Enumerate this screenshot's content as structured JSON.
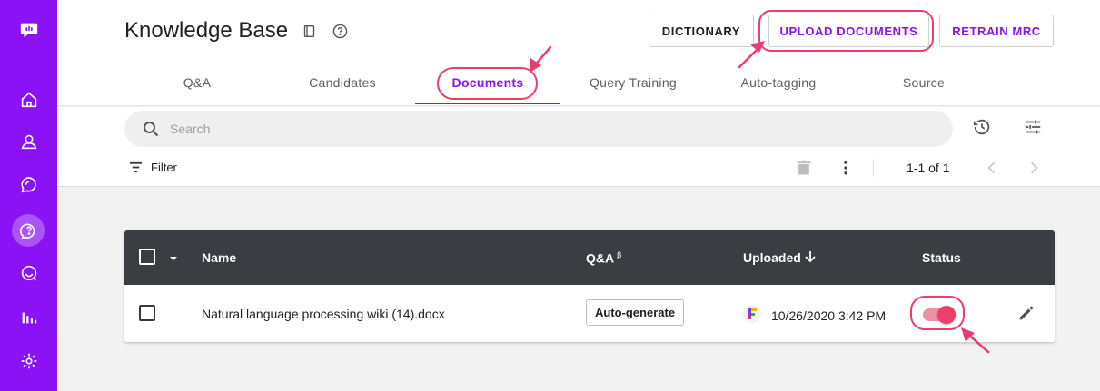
{
  "header": {
    "title": "Knowledge Base",
    "buttons": {
      "dictionary": "DICTIONARY",
      "upload": "UPLOAD DOCUMENTS",
      "retrain": "RETRAIN MRC"
    }
  },
  "tabs": [
    "Q&A",
    "Candidates",
    "Documents",
    "Query Training",
    "Auto-tagging",
    "Source"
  ],
  "active_tab": "Documents",
  "search": {
    "placeholder": "Search"
  },
  "filter": {
    "label": "Filter"
  },
  "pagination": {
    "range": "1-1 of 1"
  },
  "table": {
    "columns": {
      "name": "Name",
      "qa": "Q&A",
      "qa_sup": "β",
      "uploaded": "Uploaded",
      "status": "Status"
    },
    "rows": [
      {
        "name": "Natural language processing wiki (14).docx",
        "qa_action": "Auto-generate",
        "uploaded": "10/26/2020 3:42 PM",
        "status_on": true
      }
    ]
  },
  "colors": {
    "brand": "#8a12f5",
    "annotation": "#ec3d6d",
    "table_header": "#3a3d42",
    "toggle": "#ef3e68"
  },
  "icons": [
    "logo-icon",
    "home-icon",
    "user-icon",
    "chat-icon",
    "help-icon",
    "message-icon",
    "analytics-icon",
    "settings-icon",
    "book-icon",
    "help-circle-icon",
    "search-icon",
    "history-icon",
    "sliders-icon",
    "filter-icon",
    "trash-icon",
    "more-vert-icon",
    "chevron-left-icon",
    "chevron-right-icon",
    "caret-down-icon",
    "arrow-down-icon",
    "uploader-icon",
    "edit-icon"
  ]
}
